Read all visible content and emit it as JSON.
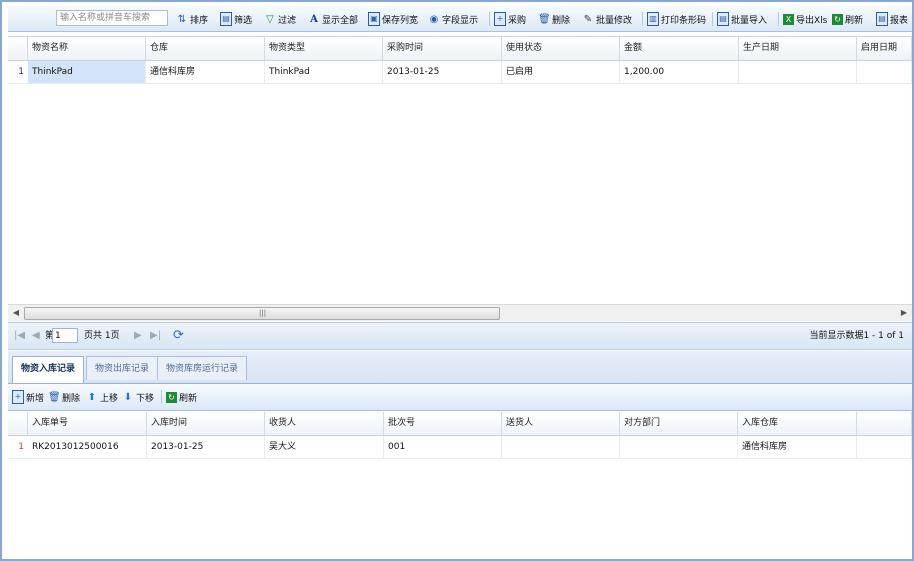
{
  "toolbar": {
    "search_placeholder": "输入名称或拼音车搜索",
    "buttons": [
      {
        "key": "sort",
        "label": "排序",
        "icon": "sort-icon"
      },
      {
        "key": "filter",
        "label": "筛选",
        "icon": "filter-icon"
      },
      {
        "key": "funnel",
        "label": "过滤",
        "icon": "funnel-icon"
      },
      {
        "key": "showall",
        "label": "显示全部",
        "icon": "font-icon"
      },
      {
        "key": "savecols",
        "label": "保存列宽",
        "icon": "save-icon"
      },
      {
        "key": "fields",
        "label": "字段显示",
        "icon": "eye-icon"
      },
      {
        "key": "purchase",
        "label": "采购",
        "icon": "add-doc-icon"
      },
      {
        "key": "delete",
        "label": "删除",
        "icon": "trash-icon"
      },
      {
        "key": "batchedit",
        "label": "批量修改",
        "icon": "pencil-icon"
      },
      {
        "key": "printbarcode",
        "label": "打印条形码",
        "icon": "barcode-icon"
      },
      {
        "key": "batchimport",
        "label": "批量导入",
        "icon": "import-icon"
      },
      {
        "key": "exportxls",
        "label": "导出Xls",
        "icon": "excel-icon"
      },
      {
        "key": "refresh",
        "label": "刷新",
        "icon": "refresh-icon"
      },
      {
        "key": "report",
        "label": "报表",
        "icon": "report-icon"
      }
    ]
  },
  "grid1": {
    "columns": [
      "物资名称",
      "仓库",
      "物资类型",
      "采购时间",
      "使用状态",
      "金额",
      "生产日期",
      "启用日期"
    ],
    "rows": [
      {
        "num": "1",
        "cells": [
          "ThinkPad",
          "通信科库房",
          "ThinkPad",
          "2013-01-25",
          "已启用",
          "1,200.00",
          "",
          ""
        ]
      }
    ]
  },
  "pager": {
    "page_prefix": "第",
    "page_value": "1",
    "page_suffix": "页共 1页",
    "status": "当前显示数据1 - 1 of 1"
  },
  "tabs": [
    {
      "label": "物资入库记录",
      "active": true
    },
    {
      "label": "物资出库记录",
      "active": false
    },
    {
      "label": "物资库房运行记录",
      "active": false
    }
  ],
  "toolbar2": {
    "buttons": [
      {
        "key": "new",
        "label": "新增",
        "icon": "add-doc-icon"
      },
      {
        "key": "delete",
        "label": "删除",
        "icon": "trash-icon"
      },
      {
        "key": "up",
        "label": "上移",
        "icon": "arrow-up-icon"
      },
      {
        "key": "down",
        "label": "下移",
        "icon": "arrow-down-icon"
      },
      {
        "key": "refresh",
        "label": "刷新",
        "icon": "refresh-icon"
      }
    ]
  },
  "grid2": {
    "columns": [
      "入库单号",
      "入库时间",
      "收货人",
      "批次号",
      "送货人",
      "对方部门",
      "入库仓库",
      ""
    ],
    "rows": [
      {
        "num": "1",
        "cells": [
          "RK2013012500016",
          "2013-01-25",
          "吴大义",
          "001",
          "",
          "",
          "通信科库房",
          ""
        ]
      }
    ]
  },
  "colors": {
    "frame": "#8aa7cf",
    "selected": "#d2e4f7",
    "rownum_red": "#c0392b"
  }
}
